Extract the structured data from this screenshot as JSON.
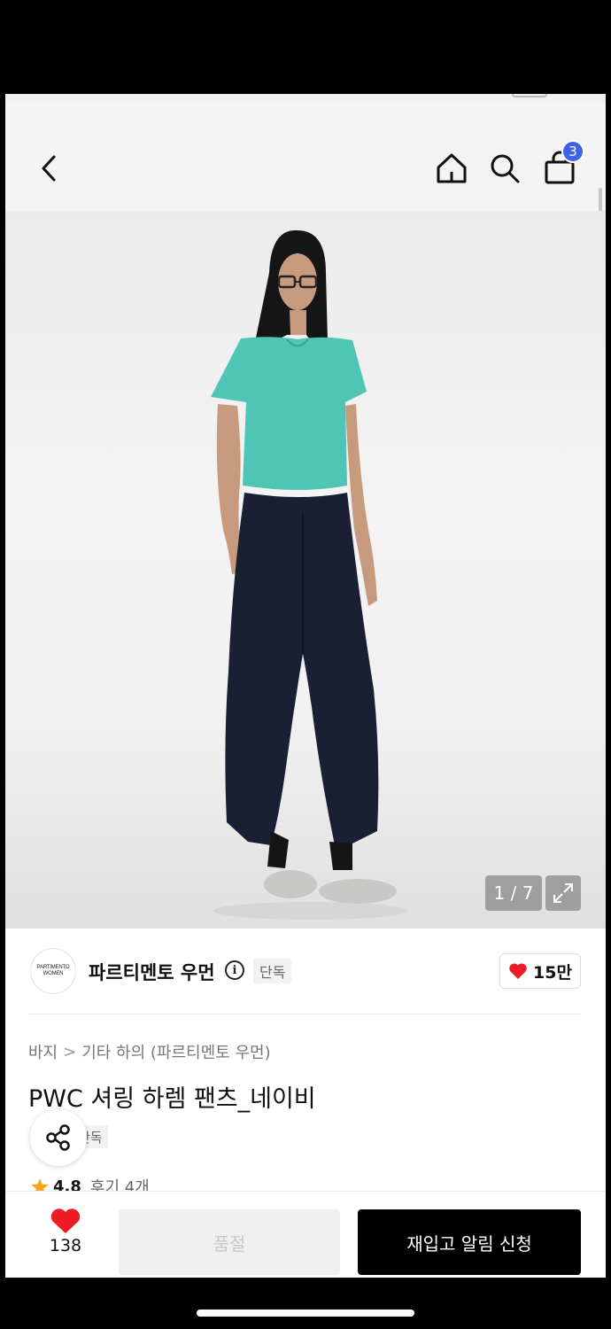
{
  "status_bar": {
    "time": "",
    "signal": ""
  },
  "header": {
    "back_icon": "chevron-left-icon",
    "home_icon": "home-icon",
    "search_icon": "search-icon",
    "cart_icon": "shopping-bag-icon",
    "cart_count": "3",
    "badge_color": "#3e63ea"
  },
  "gallery": {
    "counter": "1 / 7",
    "expand_icon": "expand-icon"
  },
  "brand": {
    "logo_line1": "PARTIMENTO",
    "logo_line2": "WOMEN",
    "name": "파르티멘토 우먼",
    "tag": "단독",
    "likes": "15만",
    "heart_color": "#ee1c25"
  },
  "breadcrumb": {
    "items": [
      "바지",
      "기타 하의 (파르티멘토 우먼)"
    ],
    "separator": ">"
  },
  "product": {
    "title": "PWC 셔링 하렘 팬츠_네이비",
    "tag": "단독",
    "rating": "4.8",
    "reviews": "후기 4개",
    "star_color": "#f5a623"
  },
  "bottom_bar": {
    "wish_count": "138",
    "soldout_label": "품절",
    "restock_label": "재입고 알림 신청"
  }
}
